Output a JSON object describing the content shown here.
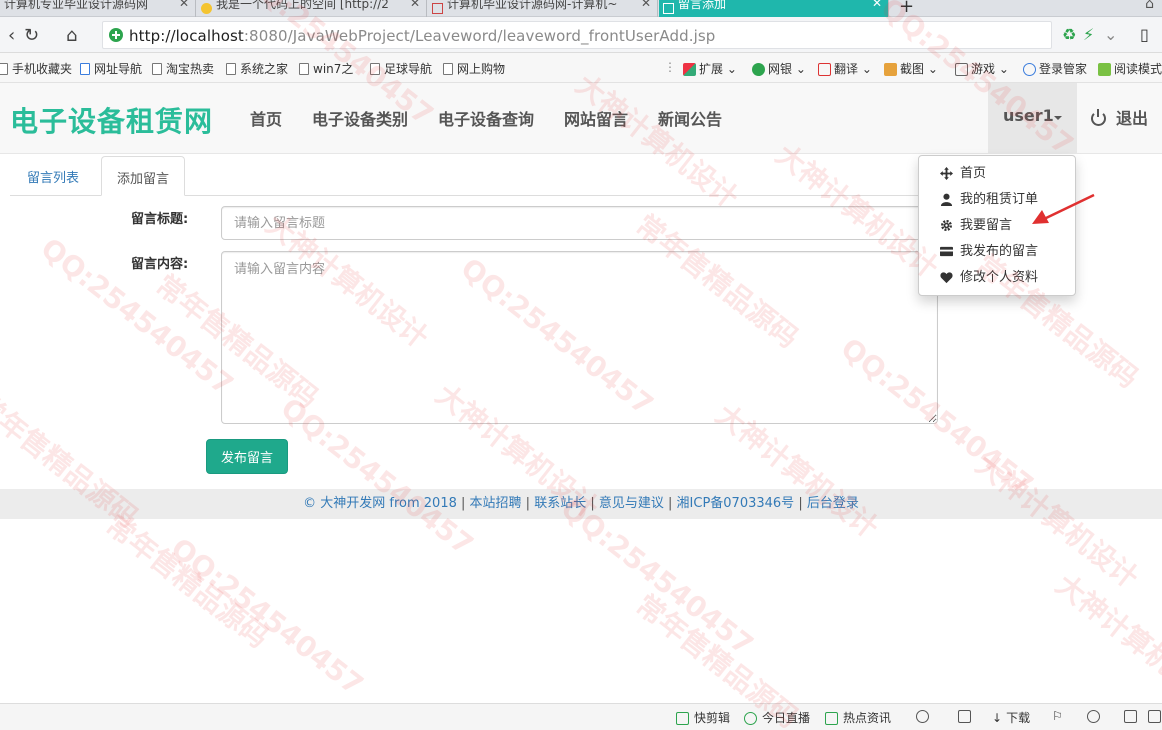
{
  "browser": {
    "tabs": [
      {
        "label": "计算机专业毕业设计源码网"
      },
      {
        "label": "我是一个代码上的空间 [http://2"
      },
      {
        "label": "计算机毕业设计源码网-计算机~"
      },
      {
        "label": "留言添加"
      }
    ],
    "url_host": "http://localhost",
    "url_path": ":8080/JavaWebProject/Leaveword/leaveword_frontUserAdd.jsp",
    "bookmarks_left": [
      "手机收藏夹",
      "网址导航",
      "淘宝热卖",
      "系统之家",
      "win7之",
      "足球导航",
      "网上购物"
    ],
    "bookmarks_right": [
      "扩展",
      "网银",
      "翻译",
      "截图",
      "游戏",
      "登录管家",
      "阅读模式"
    ]
  },
  "site": {
    "brand": "电子设备租赁网",
    "nav": [
      "首页",
      "电子设备类别",
      "电子设备查询",
      "网站留言",
      "新闻公告"
    ],
    "user": "user1",
    "logout": "退出"
  },
  "tabs": {
    "list": "留言列表",
    "add": "添加留言"
  },
  "form": {
    "title_label": "留言标题:",
    "title_placeholder": "请输入留言标题",
    "content_label": "留言内容:",
    "content_placeholder": "请输入留言内容",
    "submit": "发布留言"
  },
  "dropdown": [
    {
      "label": "首页",
      "icon": "move-icon"
    },
    {
      "label": "我的租赁订单",
      "icon": "user-icon"
    },
    {
      "label": "我要留言",
      "icon": "cog-icon"
    },
    {
      "label": "我发布的留言",
      "icon": "credit-card-icon"
    },
    {
      "label": "修改个人资料",
      "icon": "heart-icon"
    }
  ],
  "footer": {
    "copyright": "© 大神开发网 from 2018",
    "links": [
      "本站招聘",
      "联系站长",
      "意见与建议",
      "湘ICP备0703346号",
      "后台登录"
    ]
  },
  "statusbar": [
    "快剪辑",
    "今日直播",
    "热点资讯",
    "下载"
  ],
  "watermark": [
    "QQ:254540457",
    "大神计算机设计",
    "常年售精品源码"
  ],
  "colors": {
    "brand": "#2bbd9a",
    "button": "#1fa98c",
    "active_tab": "#1fb7ac",
    "link": "#337ab7"
  }
}
